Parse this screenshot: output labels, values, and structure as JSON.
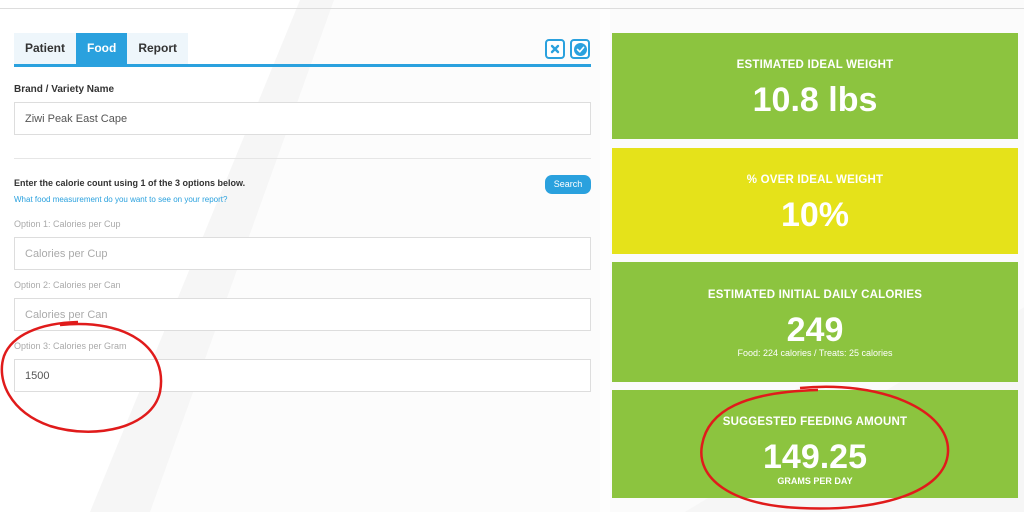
{
  "tabs": [
    "Patient",
    "Food",
    "Report"
  ],
  "active_tab": "Food",
  "toolbar": {
    "close_icon": "close-icon",
    "confirm_icon": "check-circle-icon"
  },
  "brand": {
    "label": "Brand / Variety Name",
    "value": "Ziwi Peak East Cape"
  },
  "calories": {
    "instruction": "Enter the calorie count using 1 of the 3 options below.",
    "help_link": "What food measurement do you want to see on your report?",
    "search_label": "Search",
    "options": [
      {
        "label": "Option 1: Calories per Cup",
        "placeholder": "Calories per Cup",
        "value": ""
      },
      {
        "label": "Option 2: Calories per Can",
        "placeholder": "Calories per Can",
        "value": ""
      },
      {
        "label": "Option 3: Calories per Gram",
        "placeholder": "",
        "value": "1500"
      }
    ]
  },
  "results": {
    "ideal_weight": {
      "title": "ESTIMATED IDEAL WEIGHT",
      "value": "10.8 lbs"
    },
    "over_ideal": {
      "title": "% OVER IDEAL WEIGHT",
      "value": "10%"
    },
    "daily_calories": {
      "title": "ESTIMATED INITIAL DAILY CALORIES",
      "value": "249",
      "breakdown": "Food: 224 calories / Treats: 25 calories"
    },
    "feeding": {
      "title": "SUGGESTED FEEDING AMOUNT",
      "value": "149.25",
      "unit": "GRAMS PER DAY"
    }
  },
  "colors": {
    "accent": "#2aa1de",
    "card_green": "#8cc43f",
    "card_yellow": "#e5e21a",
    "annotation": "#e01b1b"
  }
}
